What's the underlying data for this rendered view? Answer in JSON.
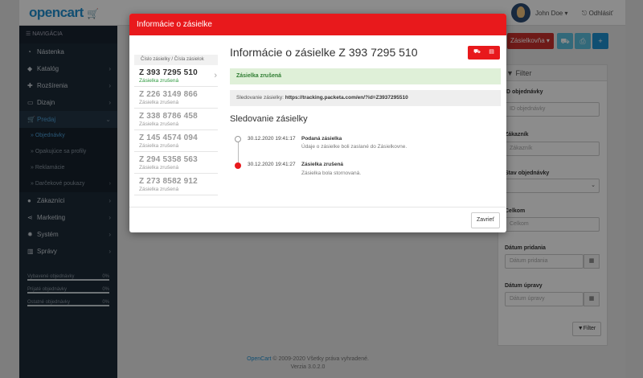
{
  "app": {
    "logo": "opencart",
    "user_name": "John Doe ▾",
    "logout": "Odhlásiť"
  },
  "sidebar": {
    "title": "NAVIGÁCIA",
    "items": [
      {
        "label": "Nástenka",
        "icon": "dashboard-icon"
      },
      {
        "label": "Katalóg",
        "icon": "tag-icon"
      },
      {
        "label": "Rozšírenia",
        "icon": "puzzle-icon"
      },
      {
        "label": "Dizajn",
        "icon": "monitor-icon"
      },
      {
        "label": "Predaj",
        "icon": "cart-icon"
      }
    ],
    "sub_items": [
      {
        "label": "Objednávky"
      },
      {
        "label": "Opakujúce sa profily"
      },
      {
        "label": "Reklamácie"
      },
      {
        "label": "Darčekové poukazy"
      }
    ],
    "items2": [
      {
        "label": "Zákazníci",
        "icon": "user-icon"
      },
      {
        "label": "Marketing",
        "icon": "share-icon"
      },
      {
        "label": "Systém",
        "icon": "gear-icon"
      },
      {
        "label": "Správy",
        "icon": "chart-icon"
      }
    ],
    "stats": [
      {
        "label": "Vybavené objednávky",
        "pct": "0%"
      },
      {
        "label": "Prijaté objednávky",
        "pct": "0%"
      },
      {
        "label": "Ostatné objednávky",
        "pct": "0%"
      }
    ]
  },
  "toolbar": {
    "packeta_label": "Zásielkovňa"
  },
  "filter": {
    "title": "Filter",
    "order_id_label": "ID objednávky",
    "order_id_placeholder": "ID objednávky",
    "customer_label": "Zákazník",
    "customer_placeholder": "Zákazník",
    "status_label": "Stav objednávky",
    "total_label": "Celkom",
    "total_placeholder": "Celkom",
    "date_added_label": "Dátum pridania",
    "date_added_placeholder": "Dátum pridania",
    "date_modified_label": "Dátum úpravy",
    "date_modified_placeholder": "Dátum úpravy",
    "button": "Filter"
  },
  "footer": {
    "brand": "OpenCart",
    "copyright": " © 2009-2020 Všetky práva vyhradené.",
    "version": "Verzia 3.0.2.0"
  },
  "modal": {
    "header": "Informácie o zásielke",
    "list_header": "Číslo zásielky / Čísla zásielok",
    "packets": [
      {
        "number": "Z 393 7295 510",
        "status": "Zásielka zrušená",
        "selected": true
      },
      {
        "number": "Z 226 3149 866",
        "status": "Zásielka zrušená"
      },
      {
        "number": "Z 338 8786 458",
        "status": "Zásielka zrušená"
      },
      {
        "number": "Z 145 4574 094",
        "status": "Zásielka zrušená"
      },
      {
        "number": "Z 294 5358 563",
        "status": "Zásielka zrušená"
      },
      {
        "number": "Z 273 8582 912",
        "status": "Zásielka zrušená"
      }
    ],
    "detail_title": "Informácie o zásielke Z 393 7295 510",
    "status": "Zásielka zrušená",
    "tracking_label": "Sledovanie zásielky:",
    "tracking_url": "https://tracking.packeta.com/en/?id=Z3937295510",
    "tracking_title": "Sledovanie zásielky",
    "timeline": [
      {
        "time": "30.12.2020 19:41:17",
        "title": "Podaná zásielka",
        "text": "Údaje o zásielke boli zaslané do Zásielkovne."
      },
      {
        "time": "30.12.2020 19:41:27",
        "title": "Zásielka zrušená",
        "text": "Zásielka bola stornovaná."
      }
    ],
    "close": "Zavrieť"
  },
  "colors": {
    "accent_red": "#e8191c",
    "brand_blue": "#1f8fcf",
    "success_bg": "#dff0d8"
  }
}
